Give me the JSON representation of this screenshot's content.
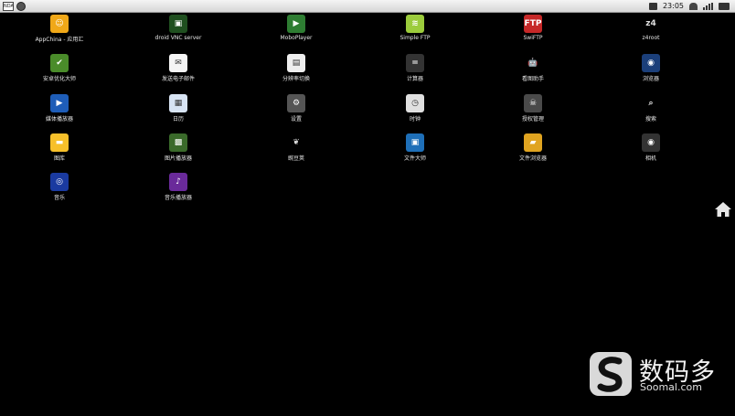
{
  "status_bar": {
    "left_logo": "NDA",
    "time": "23:05",
    "icons": [
      "screenshot-icon",
      "wifi-icon",
      "signal-icon",
      "battery-icon"
    ]
  },
  "apps": [
    {
      "label": "AppChina - 应用汇",
      "icon": "appchina-icon",
      "color": "#f0a818",
      "glyph": "☺"
    },
    {
      "label": "droid VNC server",
      "icon": "vnc-server-icon",
      "color": "#1f4f1f",
      "glyph": "▣"
    },
    {
      "label": "MoboPlayer",
      "icon": "moboplayer-icon",
      "color": "#2e7d32",
      "glyph": "▶"
    },
    {
      "label": "Simple FTP",
      "icon": "simple-ftp-icon",
      "color": "#9ccc3c",
      "glyph": "≋"
    },
    {
      "label": "SwiFTP",
      "icon": "swiftp-icon",
      "color": "#c62828",
      "glyph": "FTP"
    },
    {
      "label": "z4root",
      "icon": "z4root-icon",
      "color": "#000000",
      "glyph": "z4"
    },
    {
      "label": "安卓优化大师",
      "icon": "android-optimizer-icon",
      "color": "#4a8c2a",
      "glyph": "✔"
    },
    {
      "label": "发送电子邮件",
      "icon": "email-icon",
      "color": "#f5f5f5",
      "glyph": "✉"
    },
    {
      "label": "分辨率切换",
      "icon": "resolution-switch-icon",
      "color": "#eeeeee",
      "glyph": "▤"
    },
    {
      "label": "计算器",
      "icon": "calculator-icon",
      "color": "#333333",
      "glyph": "="
    },
    {
      "label": "看图助手",
      "icon": "android-helper-icon",
      "color": "#000000",
      "glyph": "🤖"
    },
    {
      "label": "浏览器",
      "icon": "browser-icon",
      "color": "#1b3f7a",
      "glyph": "◉"
    },
    {
      "label": "媒体播放器",
      "icon": "media-player-icon",
      "color": "#1e5db8",
      "glyph": "▶"
    },
    {
      "label": "日历",
      "icon": "calendar-icon",
      "color": "#d8e4f4",
      "glyph": "▦"
    },
    {
      "label": "设置",
      "icon": "settings-icon",
      "color": "#555555",
      "glyph": "⚙"
    },
    {
      "label": "时钟",
      "icon": "clock-icon",
      "color": "#e0e0e0",
      "glyph": "◷"
    },
    {
      "label": "授权管理",
      "icon": "superuser-icon",
      "color": "#4a4a4a",
      "glyph": "☠"
    },
    {
      "label": "搜索",
      "icon": "search-icon",
      "color": "#000000",
      "glyph": "⌕"
    },
    {
      "label": "图库",
      "icon": "gallery-icon",
      "color": "#f7c02a",
      "glyph": "▬"
    },
    {
      "label": "图片播放器",
      "icon": "picture-player-icon",
      "color": "#3a6a2a",
      "glyph": "▩"
    },
    {
      "label": "豌豆荚",
      "icon": "wandoujia-icon",
      "color": "#000000",
      "glyph": "❦"
    },
    {
      "label": "文件大师",
      "icon": "file-master-icon",
      "color": "#1e6fb8",
      "glyph": "▣"
    },
    {
      "label": "文件浏览器",
      "icon": "file-browser-icon",
      "color": "#e0a420",
      "glyph": "▰"
    },
    {
      "label": "相机",
      "icon": "camera-icon",
      "color": "#333333",
      "glyph": "◉"
    },
    {
      "label": "音乐",
      "icon": "music-icon",
      "color": "#1a3aa0",
      "glyph": "◎"
    },
    {
      "label": "音乐播放器",
      "icon": "music-player-icon",
      "color": "#6a2a9a",
      "glyph": "♪"
    }
  ],
  "home_button": {
    "icon": "home-icon"
  },
  "watermark": {
    "chinese": "数码多",
    "english": "Soomal.com"
  }
}
